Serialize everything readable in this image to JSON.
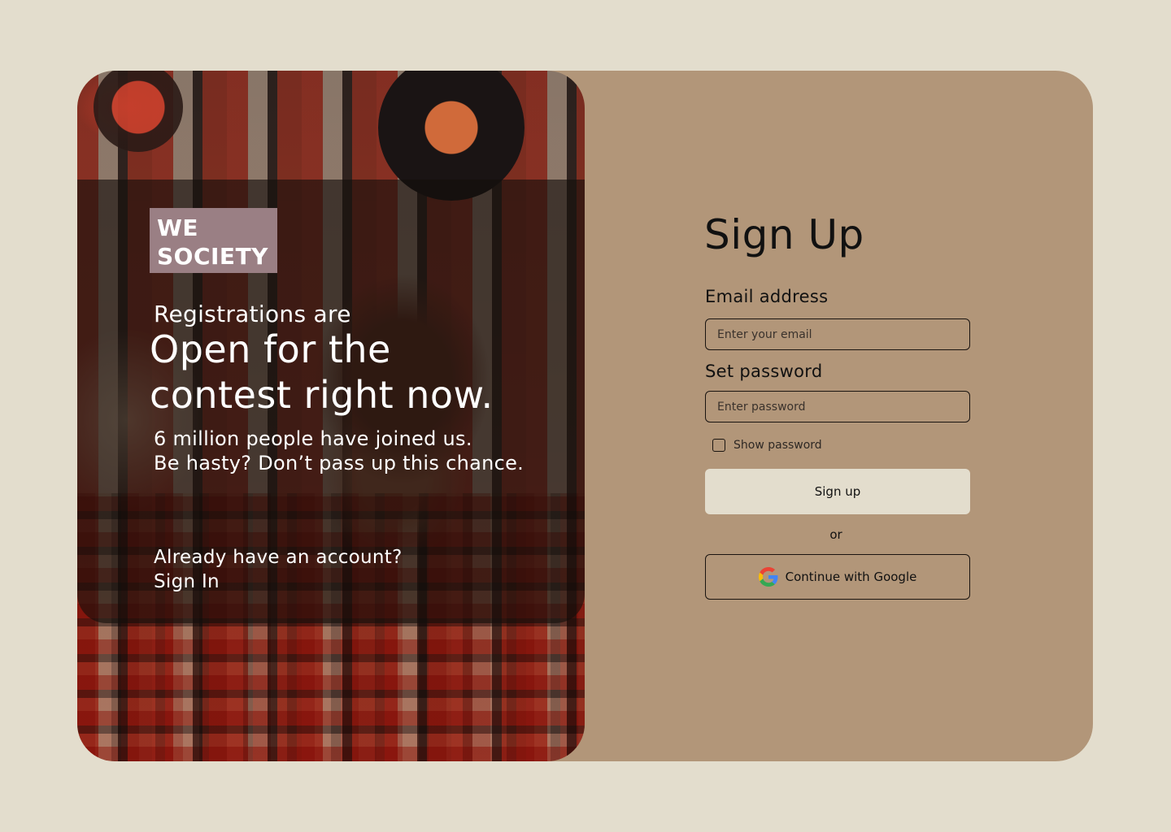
{
  "brand": {
    "name": "WE\nSOCIETY",
    "box_color": "#9a7f84"
  },
  "promo": {
    "lead": "Registrations are",
    "headline": "Open for the\ncontest right now.",
    "subtext_line1": "6 million people have joined us.",
    "subtext_line2": "Be hasty? Don’t pass up this chance.",
    "already_text": "Already have an account?",
    "signin_label": "Sign In"
  },
  "form": {
    "title": "Sign Up",
    "email": {
      "label": "Email address",
      "placeholder": "Enter your email",
      "value": ""
    },
    "password": {
      "label": "Set password",
      "placeholder": "Enter password",
      "value": ""
    },
    "show_password": {
      "label": "Show password",
      "checked": false
    },
    "submit_label": "Sign up",
    "divider_text": "or",
    "google_label": "Continue with Google",
    "google_icon": "google-logo-icon"
  },
  "colors": {
    "page_background": "#e3ddcd",
    "card_background": "#b29679",
    "button_background": "#e3ddcd",
    "text_dark": "#111111",
    "text_light": "#ffffff"
  }
}
